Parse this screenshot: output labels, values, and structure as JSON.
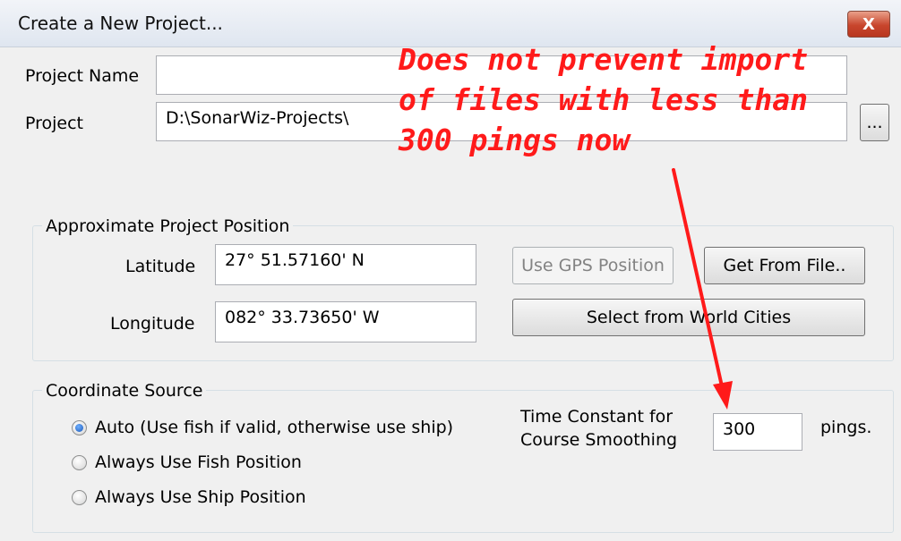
{
  "window": {
    "title": "Create a New Project...",
    "close_label": "X"
  },
  "project": {
    "name_label": "Project Name",
    "name_value": "",
    "path_label": "Project",
    "path_value": "D:\\SonarWiz-Projects\\",
    "browse_label": "..."
  },
  "position": {
    "group_label": "Approximate Project Position",
    "latitude_label": "Latitude",
    "latitude_value": "27° 51.57160' N",
    "longitude_label": "Longitude",
    "longitude_value": "082° 33.73650' W",
    "use_gps_label": "Use GPS Position",
    "get_from_file_label": "Get From File..",
    "world_cities_label": "Select from World Cities"
  },
  "coordinate_source": {
    "group_label": "Coordinate Source",
    "options": [
      {
        "label": "Auto (Use fish if valid, otherwise use ship)",
        "selected": true
      },
      {
        "label": "Always Use Fish Position",
        "selected": false
      },
      {
        "label": "Always Use Ship Position",
        "selected": false
      }
    ],
    "time_constant_label_line1": "Time Constant for",
    "time_constant_label_line2": "Course Smoothing",
    "time_constant_value": "300",
    "units_label": "pings."
  },
  "annotation": {
    "line1": "Does not prevent import",
    "line2": "of files with less than",
    "line3": "300 pings now",
    "color": "#ff1a1a"
  }
}
